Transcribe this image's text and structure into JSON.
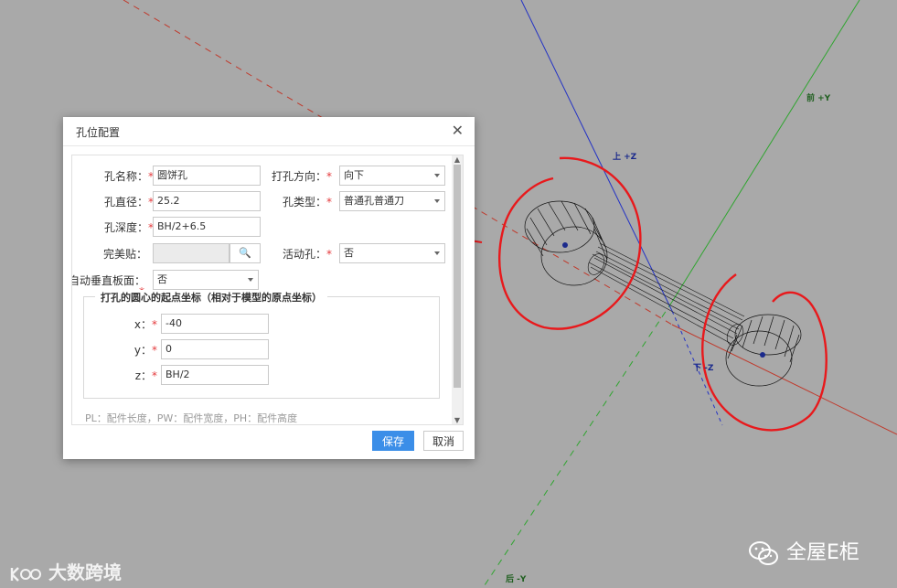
{
  "scene": {
    "axis_labels": {
      "front_y": "前 +Y",
      "up_z": "上 +Z",
      "down_z": "下 -Z",
      "back_y": "后 -Y"
    }
  },
  "dialog": {
    "title": "孔位配置",
    "close_glyph": "✕",
    "fields": {
      "hole_name": {
        "label": "孔名称：",
        "value": "圆饼孔"
      },
      "hole_diameter": {
        "label": "孔直径：",
        "value": "25.2"
      },
      "hole_depth": {
        "label": "孔深度：",
        "value": "BH/2+6.5"
      },
      "perfect_fit": {
        "label": "完美贴：",
        "value": ""
      },
      "auto_vertical": {
        "label": "自动垂直板面：",
        "value": "否"
      },
      "drill_direction": {
        "label": "打孔方向：",
        "value": "向下"
      },
      "hole_type": {
        "label": "孔类型：",
        "value": "普通孔普通刀"
      },
      "movable_hole": {
        "label": "活动孔：",
        "value": "否"
      }
    },
    "required_mark": "*",
    "search_glyph": "🔍",
    "coords": {
      "legend": "打孔的圆心的起点坐标（相对于模型的原点坐标）",
      "x": {
        "label": "x：",
        "value": "-40"
      },
      "y": {
        "label": "y：",
        "value": "0"
      },
      "z": {
        "label": "z：",
        "value": "BH/2"
      }
    },
    "hint": "PL：配件长度，PW：配件宽度，PH：配件高度",
    "buttons": {
      "save": "保存",
      "cancel": "取消"
    }
  },
  "watermarks": {
    "left": "大数跨境",
    "right": "全屋E柜"
  },
  "colors": {
    "background": "#a9a9a9",
    "annotation_red": "#e8191c",
    "primary_button": "#3b8ee8",
    "axis_x": "#c0392b",
    "axis_y": "#2fa52f",
    "axis_z": "#2433c4"
  }
}
